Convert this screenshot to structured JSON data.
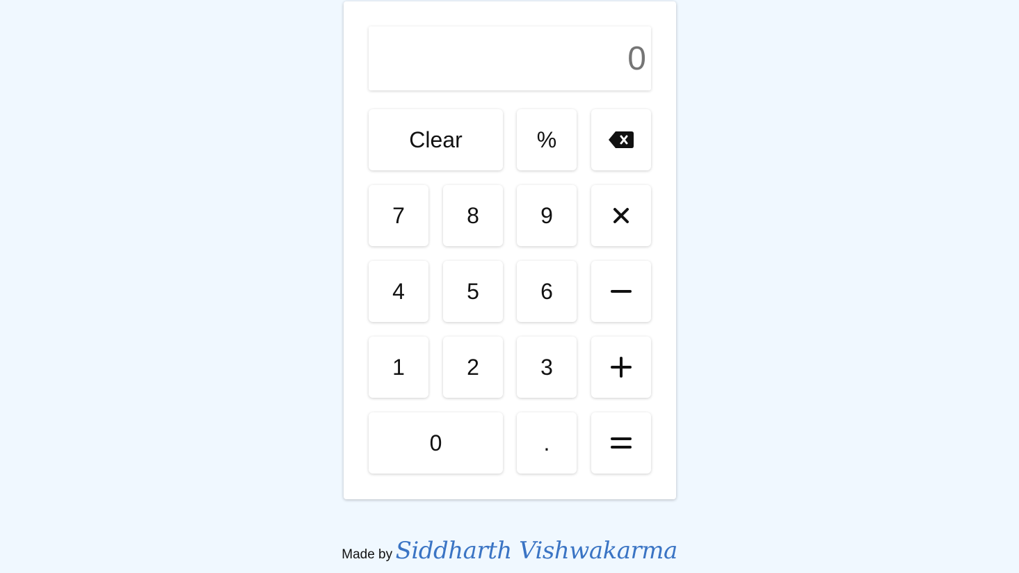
{
  "display": {
    "value": "0"
  },
  "buttons": {
    "clear": "Clear",
    "percent": "%",
    "backspace_icon": "backspace-icon",
    "seven": "7",
    "eight": "8",
    "nine": "9",
    "multiply_icon": "multiply-icon",
    "four": "4",
    "five": "5",
    "six": "6",
    "minus_icon": "minus-icon",
    "one": "1",
    "two": "2",
    "three": "3",
    "plus_icon": "plus-icon",
    "zero": "0",
    "decimal": ".",
    "equals_icon": "equals-icon"
  },
  "footer": {
    "prefix": "Made by",
    "author": "Siddharth Vishwakarma"
  },
  "colors": {
    "background": "#f0f8ff",
    "card": "#ffffff",
    "display_text": "#757575",
    "author": "#3a74c4"
  }
}
